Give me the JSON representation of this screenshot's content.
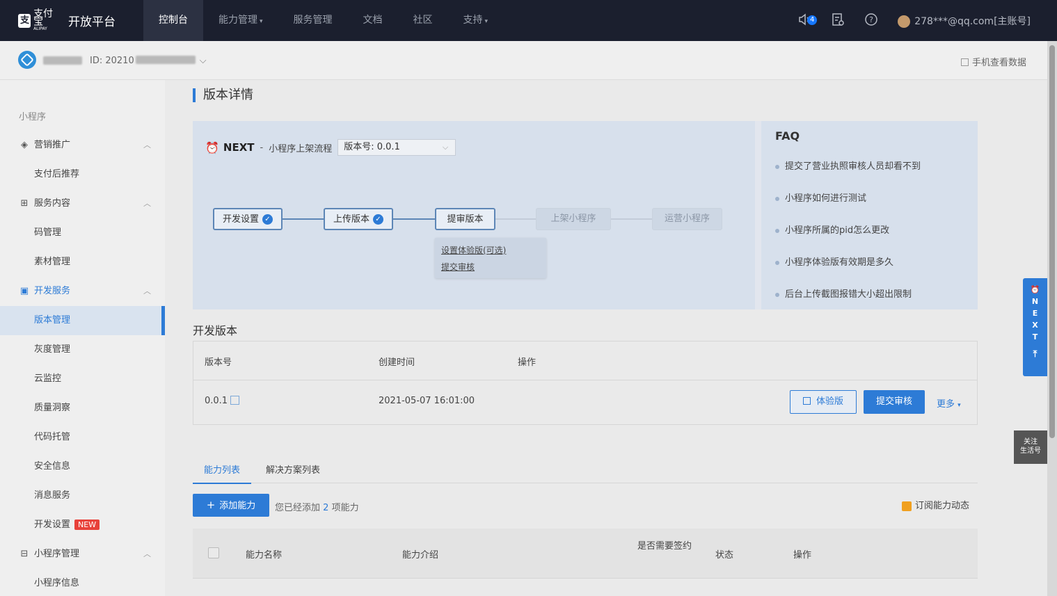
{
  "topnav": {
    "brand_small": "支付宝",
    "brand_sub": "ALIPAY",
    "brand_title": "开放平台",
    "items": [
      {
        "label": "控制台"
      },
      {
        "label": "能力管理",
        "caret": "▾"
      },
      {
        "label": "服务管理"
      },
      {
        "label": "文档"
      },
      {
        "label": "社区"
      },
      {
        "label": "支持",
        "caret": "▾"
      }
    ],
    "notif_count": "4",
    "account": "278***@qq.com[主账号]"
  },
  "subheader": {
    "id_label": "ID: 20210",
    "mobile_data": "手机查看数据"
  },
  "sidebar": {
    "section": "小程序",
    "items": [
      {
        "label": "营销推广"
      },
      {
        "label": "支付后推荐"
      },
      {
        "label": "服务内容"
      },
      {
        "label": "码管理"
      },
      {
        "label": "素材管理"
      },
      {
        "label": "开发服务"
      },
      {
        "label": "版本管理"
      },
      {
        "label": "灰度管理"
      },
      {
        "label": "云监控"
      },
      {
        "label": "质量洞察"
      },
      {
        "label": "代码托管"
      },
      {
        "label": "安全信息"
      },
      {
        "label": "消息服务"
      },
      {
        "label": "开发设置"
      },
      {
        "label": "小程序管理"
      },
      {
        "label": "小程序信息"
      }
    ],
    "new_tag": "NEW"
  },
  "main": {
    "page_title": "版本详情",
    "next": {
      "word": "NEXT",
      "dash": "-",
      "subtitle": "小程序上架流程",
      "version_select": "版本号: 0.0.1",
      "steps": [
        {
          "label": "开发设置"
        },
        {
          "label": "上传版本"
        },
        {
          "label": "提审版本"
        },
        {
          "label": "上架小程序"
        },
        {
          "label": "运营小程序"
        }
      ],
      "substeps": [
        "设置体验版(可选)",
        "提交审核"
      ]
    },
    "faq": {
      "title": "FAQ",
      "items": [
        "提交了营业执照审核人员却看不到",
        "小程序如何进行测试",
        "小程序所属的pid怎么更改",
        "小程序体验版有效期是多久",
        "后台上传截图报错大小超出限制"
      ]
    },
    "dev_version": {
      "title": "开发版本",
      "headers": [
        "版本号",
        "创建时间",
        "操作"
      ],
      "row": {
        "version": "0.0.1",
        "created": "2021-05-07 16:01:00",
        "btn_experience": "体验版",
        "btn_submit": "提交审核",
        "more": "更多"
      }
    },
    "tabs": [
      "能力列表",
      "解决方案列表"
    ],
    "add_capability": "添加能力",
    "added_prefix": "您已经添加",
    "added_count": "2",
    "added_suffix": "项能力",
    "subscribe": "订阅能力动态",
    "cap_headers": {
      "name": "能力名称",
      "intro": "能力介绍",
      "sign": "是否需要签约",
      "status": "状态",
      "ops": "操作"
    }
  },
  "float": {
    "next_letters": [
      "N",
      "E",
      "X",
      "T"
    ],
    "follow_line1": "关注",
    "follow_line2": "生活号"
  }
}
